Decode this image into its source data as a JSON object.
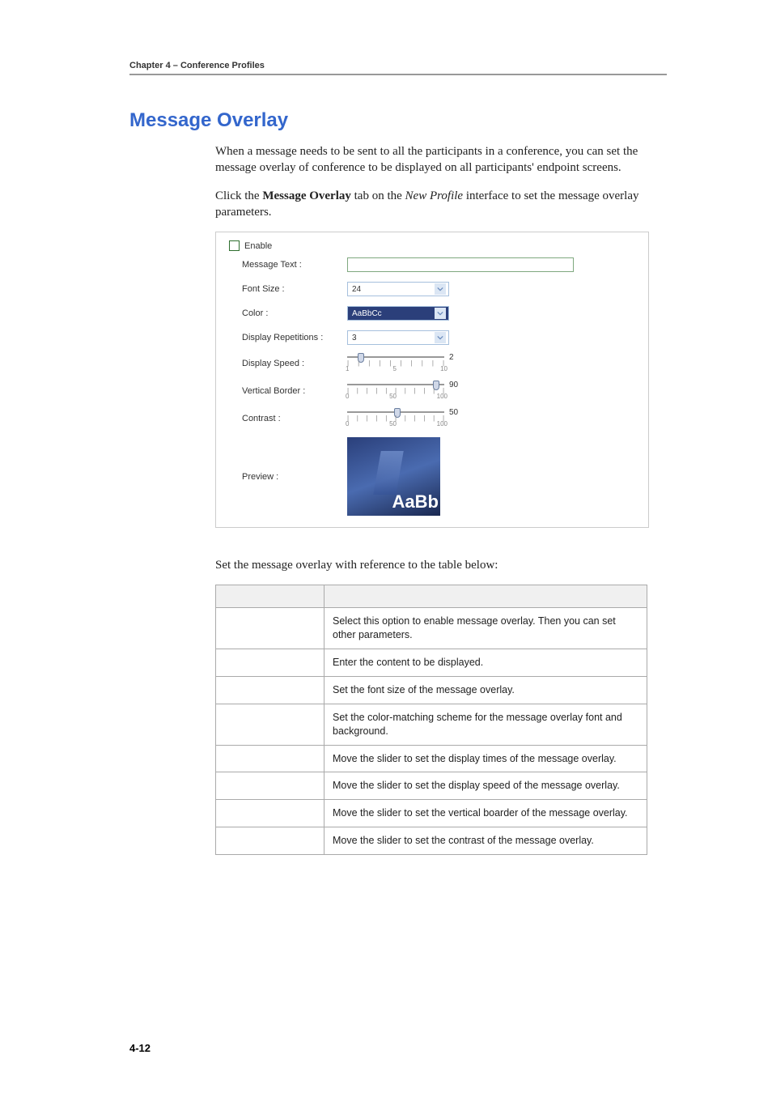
{
  "chapter_header": "Chapter 4 – Conference Profiles",
  "section_title": "Message Overlay",
  "paragraphs": {
    "p1": "When a message needs to be sent to all the participants in a conference, you can set the message overlay of conference to be displayed on all participants' endpoint screens.",
    "p2_pre": "Click the ",
    "p2_bold": "Message Overlay",
    "p2_mid": " tab on the ",
    "p2_italic": "New Profile",
    "p2_post": " interface to set the message overlay parameters.",
    "p3": "Set the message overlay with reference to the table below:"
  },
  "form": {
    "enable_label": "Enable",
    "labels": {
      "message_text": "Message Text :",
      "font_size": "Font Size :",
      "color": "Color :",
      "display_repetitions": "Display Repetitions :",
      "display_speed": "Display Speed :",
      "vertical_border": "Vertical Border :",
      "contrast": "Contrast :",
      "preview": "Preview :"
    },
    "values": {
      "font_size": "24",
      "color": "AaBbCc",
      "display_repetitions": "3",
      "display_speed": "2",
      "vertical_border": "90",
      "contrast": "50"
    },
    "slider_scales": {
      "speed": {
        "min": "1",
        "mid": "5",
        "max": "10"
      },
      "vborder": {
        "min": "0",
        "mid": "50",
        "max": "100"
      },
      "contrast": {
        "min": "0",
        "mid": "50",
        "max": "100"
      }
    },
    "preview_text": "AaBb"
  },
  "table": {
    "headers": {
      "param": "",
      "desc": ""
    },
    "rows": [
      {
        "desc": "Select this option to enable message overlay. Then you can set other parameters."
      },
      {
        "desc": "Enter the content to be displayed."
      },
      {
        "desc": "Set the font size of the message overlay."
      },
      {
        "desc": "Set the color-matching scheme for the message overlay font and background."
      },
      {
        "desc": "Move the slider to set the display times of the message overlay."
      },
      {
        "desc": "Move the slider to set the display speed of the message overlay."
      },
      {
        "desc": "Move the slider to set the vertical boarder of the message overlay."
      },
      {
        "desc": "Move the slider to set the contrast of the message overlay."
      }
    ]
  },
  "page_number": "4-12"
}
